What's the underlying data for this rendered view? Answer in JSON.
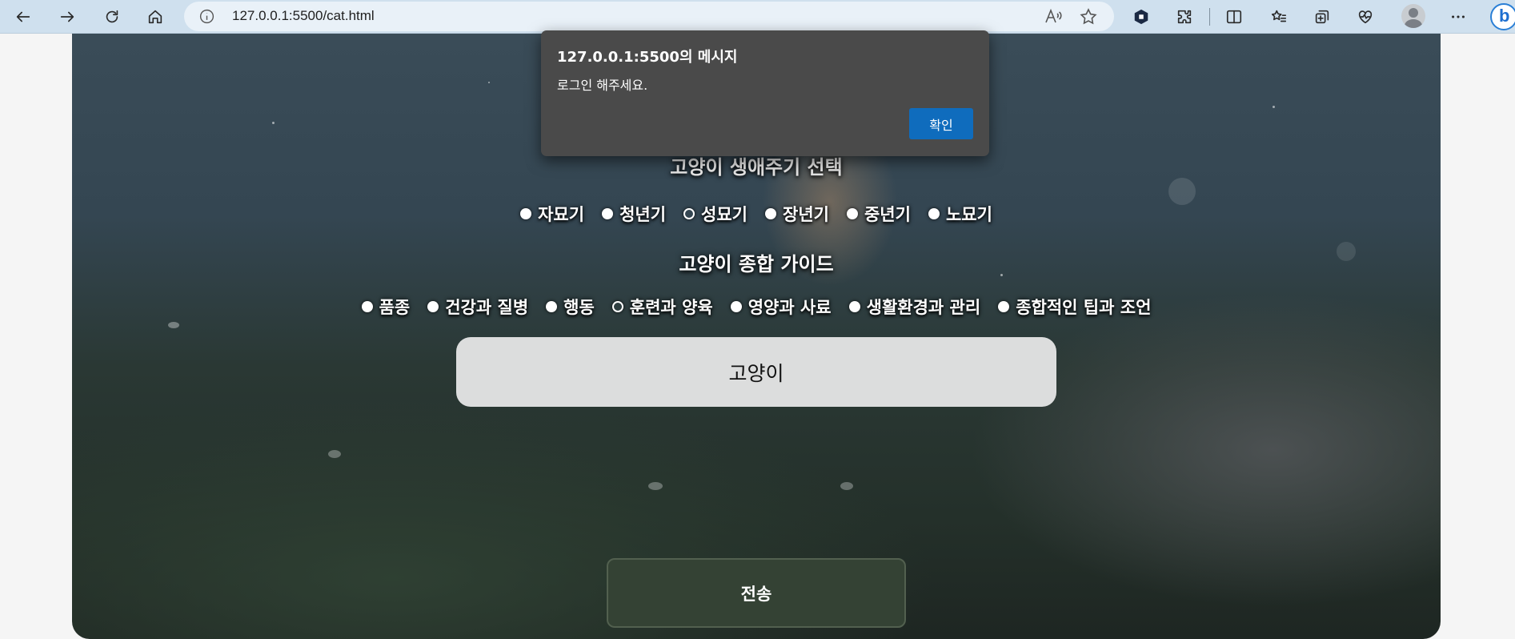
{
  "browser": {
    "url": "127.0.0.1:5500/cat.html"
  },
  "page": {
    "lifecycle_heading": "고양이 생애주기 선택",
    "lifecycle_options": [
      {
        "label": "자묘기",
        "checked": false
      },
      {
        "label": "청년기",
        "checked": false
      },
      {
        "label": "성묘기",
        "checked": true
      },
      {
        "label": "장년기",
        "checked": false
      },
      {
        "label": "중년기",
        "checked": false
      },
      {
        "label": "노묘기",
        "checked": false
      }
    ],
    "guide_heading": "고양이 종합 가이드",
    "guide_options": [
      {
        "label": "품종",
        "checked": false
      },
      {
        "label": "건강과 질병",
        "checked": false
      },
      {
        "label": "행동",
        "checked": false
      },
      {
        "label": "훈련과 양육",
        "checked": true
      },
      {
        "label": "영양과 사료",
        "checked": false
      },
      {
        "label": "생활환경과 관리",
        "checked": false
      },
      {
        "label": "종합적인 팁과 조언",
        "checked": false
      }
    ],
    "text_value": "고양이",
    "submit_label": "전송"
  },
  "alert": {
    "title": "127.0.0.1:5500의 메시지",
    "message": "로그인 해주세요.",
    "ok_label": "확인"
  }
}
